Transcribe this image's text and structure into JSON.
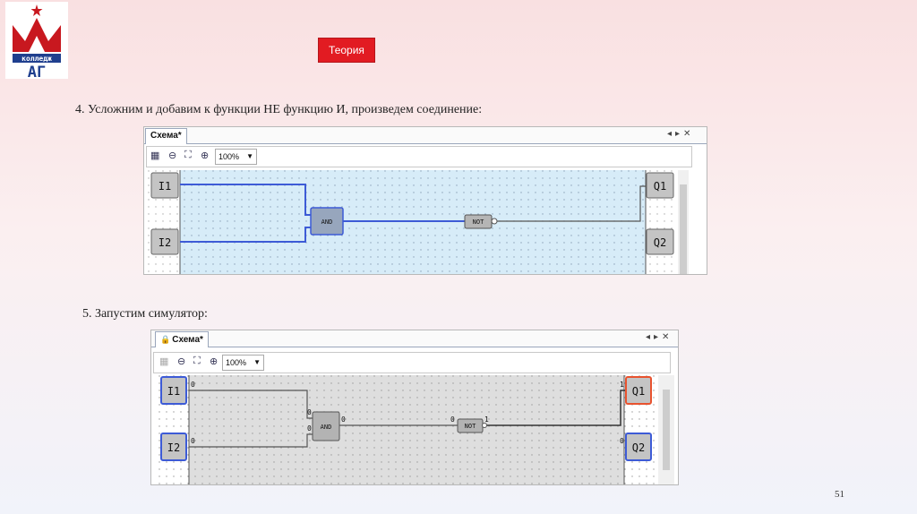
{
  "header": {
    "logo_text": "колледж АГ",
    "tag_label": "Теория"
  },
  "step4": {
    "caption": "4. Усложним и добавим к функции НЕ функцию И, произведем соединение:",
    "window": {
      "tab_label": "Схема*",
      "zoom_value": "100%",
      "inputs": [
        "I1",
        "I2"
      ],
      "outputs": [
        "Q1",
        "Q2"
      ],
      "and_label": "AND",
      "not_label": "NOT"
    }
  },
  "step5": {
    "caption": "5. Запустим симулятор:",
    "window": {
      "tab_label": "Схема*",
      "zoom_value": "100%",
      "inputs": [
        "I1",
        "I2"
      ],
      "outputs": [
        "Q1",
        "Q2"
      ],
      "and_label": "AND",
      "not_label": "NOT",
      "signals": {
        "i1": "0",
        "i2": "0",
        "and_in1": "0",
        "and_in2": "0",
        "and_out": "0",
        "not_in": "0",
        "not_out": "1",
        "q1": "1",
        "q2": "0"
      }
    }
  },
  "footer": {
    "page_number": "51"
  },
  "colors": {
    "accent_red": "#e21b22",
    "wire_blue": "#3d5bd6",
    "canvas_blue": "#d7ecf8",
    "active_red": "#e8532f"
  }
}
